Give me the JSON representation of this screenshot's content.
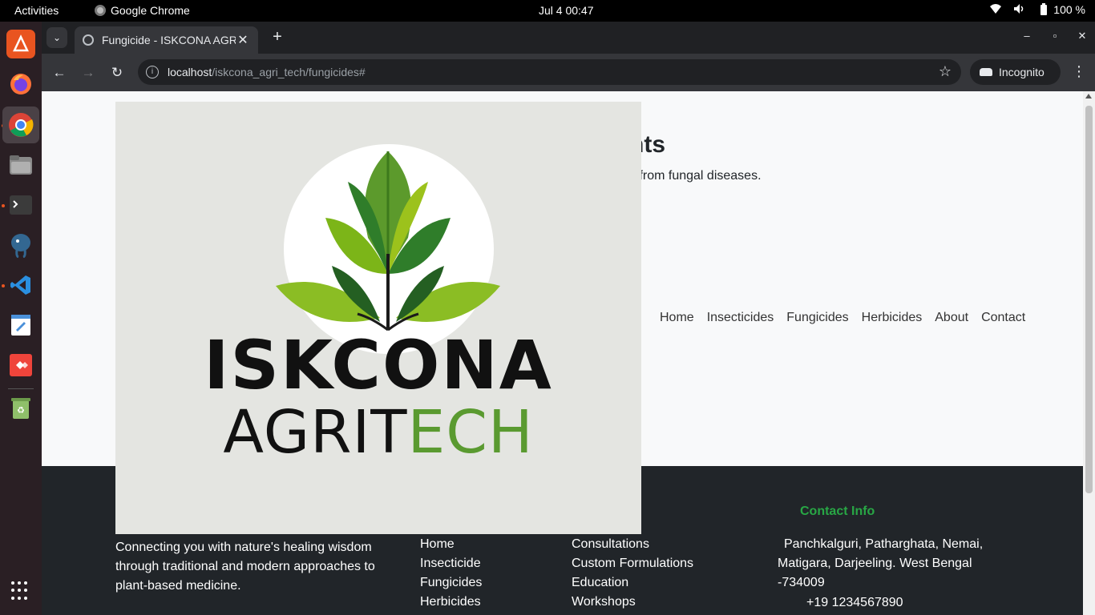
{
  "system": {
    "activities": "Activities",
    "app_name": "Google Chrome",
    "clock": "Jul 4  00:47",
    "battery": "100 %"
  },
  "dock": {
    "apps": [
      "ubuntu-software-icon",
      "firefox-icon",
      "chrome-icon",
      "files-icon",
      "terminal-icon",
      "pgadmin-icon",
      "vscode-icon",
      "text-editor-icon",
      "anydesk-icon",
      "trash-icon"
    ]
  },
  "browser": {
    "tab_title": "Fungicide - ISKCONA AGRI",
    "url_host": "localhost",
    "url_path": "/iskcona_agri_tech/fungicides#",
    "incognito_label": "Incognito"
  },
  "page": {
    "hero_title": "nts",
    "hero_subtitle": "s from fungal diseases.",
    "nav": [
      "Home",
      "Insecticides",
      "Fungicides",
      "Herbicides",
      "About",
      "Contact"
    ],
    "logo": {
      "line1": "ISKCONA",
      "line2_main": "AGRIT",
      "line2_accent": "ECH"
    },
    "footer": {
      "about_text": "Connecting you with nature's healing wisdom through traditional and modern approaches to plant-based medicine.",
      "links": [
        "Home",
        "Insecticide",
        "Fungicides",
        "Herbicides"
      ],
      "services": [
        "Consultations",
        "Custom Formulations",
        "Education",
        "Workshops"
      ],
      "contact_heading": "Contact Info",
      "address": "Panchkalguri, Patharghata, Nemai, Matigara, Darjeeling. West Bengal -734009",
      "phone": "+19 1234567890"
    }
  },
  "colors": {
    "footer_bg": "#212529",
    "accent_green": "#28a745",
    "logo_green": "#5a9a30"
  }
}
